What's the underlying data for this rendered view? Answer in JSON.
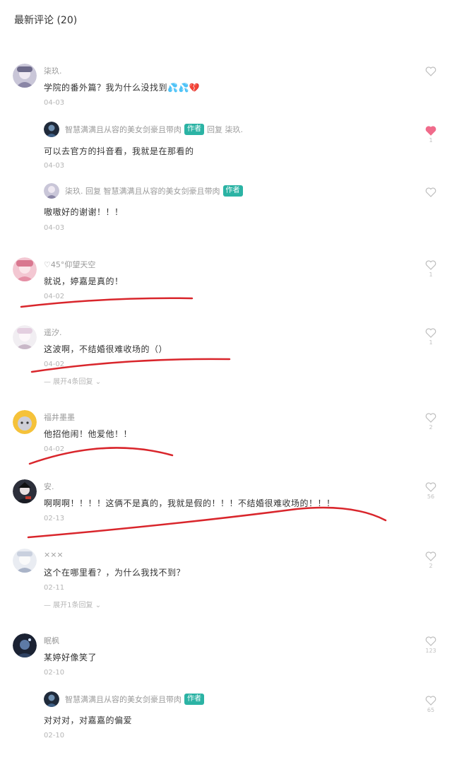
{
  "header": {
    "title": "最新评论 (20)"
  },
  "colors": {
    "accent": "#2bb3a4",
    "like_active": "#f06b8b",
    "red_marks": "#d9262c"
  },
  "comments": [
    {
      "name": "柒玖.",
      "text": "学院的番外篇？我为什么没找到💦💦💔",
      "date": "04-03",
      "likes": "",
      "liked": false,
      "replies": [
        {
          "name": "智慧满满且从容的美女剑豪且带肉",
          "badge": "作者",
          "reply_to": "回复 柒玖.",
          "text": "可以去官方的抖音看，我就是在那看的",
          "date": "04-03",
          "likes": "1",
          "liked": true
        },
        {
          "name": "柒玖. 回复 智慧满满且从容的美女剑豪且带肉",
          "badge": "作者",
          "reply_to": "",
          "text": "嗷嗷好的谢谢！！！",
          "date": "04-03",
          "likes": "",
          "liked": false
        }
      ]
    },
    {
      "name": "♡45°仰望天空",
      "text": "就说，婷嘉是真的！",
      "date": "04-02",
      "likes": "1",
      "liked": false
    },
    {
      "name": "遥汐.",
      "text": "这波啊，不结婚很难收场的（）",
      "date": "04-02",
      "likes": "1",
      "liked": false,
      "more": "— 展开4条回复 ⌄"
    },
    {
      "name": "福井墨墨",
      "text": "他招他闹！他爱他！！",
      "date": "04-02",
      "likes": "2",
      "liked": false
    },
    {
      "name": "安.",
      "text": "啊啊啊！！！！这俩不是真的，我就是假的！！！不结婚很难收场的！！！",
      "date": "02-13",
      "likes": "56",
      "liked": false
    },
    {
      "name": "×××",
      "text": "这个在哪里看？，为什么我找不到？",
      "date": "02-11",
      "likes": "2",
      "liked": false,
      "more": "— 展开1条回复 ⌄"
    },
    {
      "name": "眠枫",
      "text": "某婷好像笑了",
      "date": "02-10",
      "likes": "123",
      "liked": false,
      "replies": [
        {
          "name": "智慧满满且从容的美女剑豪且带肉",
          "badge": "作者",
          "reply_to": "",
          "text": "对对对，对嘉嘉的偏爱",
          "date": "02-10",
          "likes": "65",
          "liked": false
        }
      ]
    }
  ]
}
